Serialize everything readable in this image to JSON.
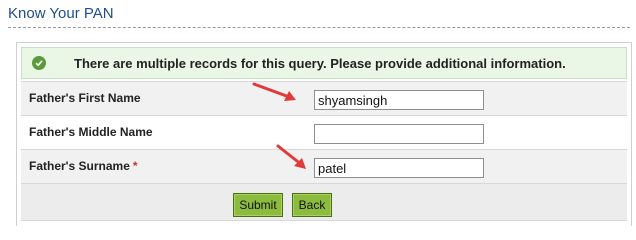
{
  "header": {
    "title": "Know Your PAN"
  },
  "notice": {
    "text": "There are multiple records for this query. Please provide additional information.",
    "icon": "check-circle-icon",
    "color": "#5c9b3a"
  },
  "form": {
    "fathers_first_name": {
      "label": "Father's First Name",
      "value": "shyamsingh"
    },
    "fathers_middle_name": {
      "label": "Father's Middle Name",
      "value": ""
    },
    "fathers_surname": {
      "label": "Father's Surname",
      "required_mark": "*",
      "value": "patel"
    }
  },
  "actions": {
    "submit_label": "Submit",
    "back_label": "Back"
  },
  "annotations": {
    "arrow_color": "#e03a3a"
  }
}
